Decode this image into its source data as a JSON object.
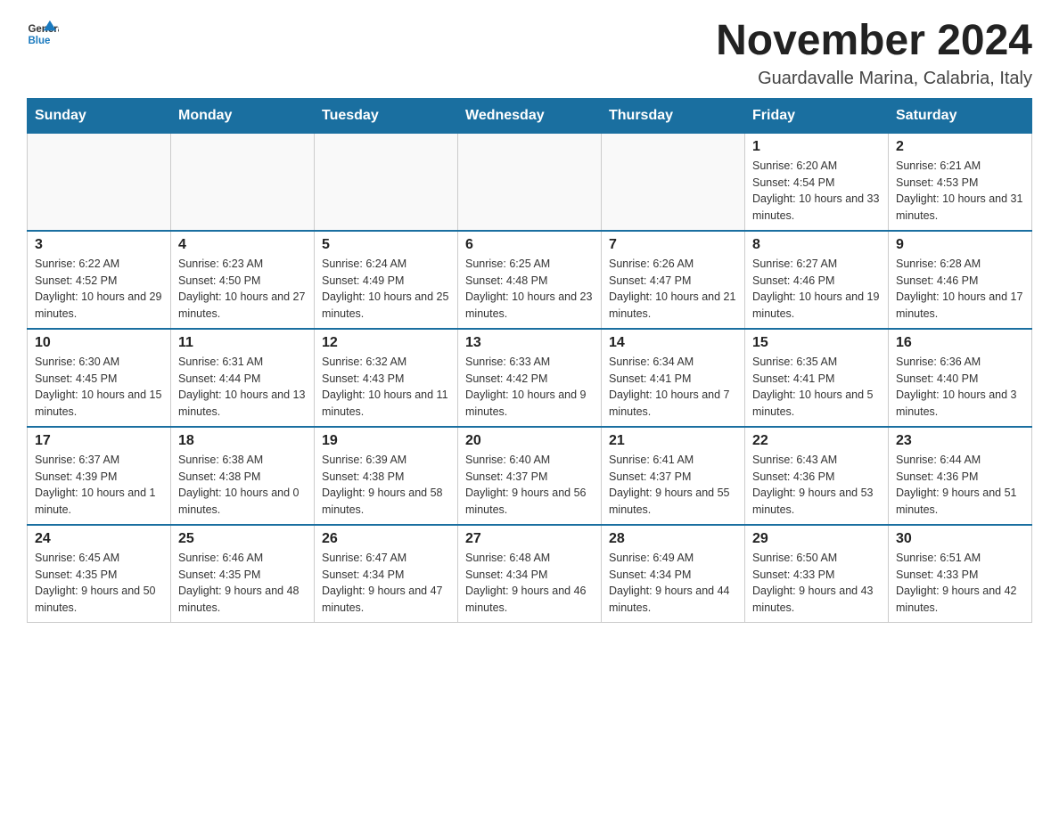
{
  "header": {
    "logo": {
      "text1": "General",
      "text2": "Blue"
    },
    "title": "November 2024",
    "location": "Guardavalle Marina, Calabria, Italy"
  },
  "days_of_week": [
    "Sunday",
    "Monday",
    "Tuesday",
    "Wednesday",
    "Thursday",
    "Friday",
    "Saturday"
  ],
  "weeks": [
    [
      {
        "day": "",
        "info": ""
      },
      {
        "day": "",
        "info": ""
      },
      {
        "day": "",
        "info": ""
      },
      {
        "day": "",
        "info": ""
      },
      {
        "day": "",
        "info": ""
      },
      {
        "day": "1",
        "info": "Sunrise: 6:20 AM\nSunset: 4:54 PM\nDaylight: 10 hours and 33 minutes."
      },
      {
        "day": "2",
        "info": "Sunrise: 6:21 AM\nSunset: 4:53 PM\nDaylight: 10 hours and 31 minutes."
      }
    ],
    [
      {
        "day": "3",
        "info": "Sunrise: 6:22 AM\nSunset: 4:52 PM\nDaylight: 10 hours and 29 minutes."
      },
      {
        "day": "4",
        "info": "Sunrise: 6:23 AM\nSunset: 4:50 PM\nDaylight: 10 hours and 27 minutes."
      },
      {
        "day": "5",
        "info": "Sunrise: 6:24 AM\nSunset: 4:49 PM\nDaylight: 10 hours and 25 minutes."
      },
      {
        "day": "6",
        "info": "Sunrise: 6:25 AM\nSunset: 4:48 PM\nDaylight: 10 hours and 23 minutes."
      },
      {
        "day": "7",
        "info": "Sunrise: 6:26 AM\nSunset: 4:47 PM\nDaylight: 10 hours and 21 minutes."
      },
      {
        "day": "8",
        "info": "Sunrise: 6:27 AM\nSunset: 4:46 PM\nDaylight: 10 hours and 19 minutes."
      },
      {
        "day": "9",
        "info": "Sunrise: 6:28 AM\nSunset: 4:46 PM\nDaylight: 10 hours and 17 minutes."
      }
    ],
    [
      {
        "day": "10",
        "info": "Sunrise: 6:30 AM\nSunset: 4:45 PM\nDaylight: 10 hours and 15 minutes."
      },
      {
        "day": "11",
        "info": "Sunrise: 6:31 AM\nSunset: 4:44 PM\nDaylight: 10 hours and 13 minutes."
      },
      {
        "day": "12",
        "info": "Sunrise: 6:32 AM\nSunset: 4:43 PM\nDaylight: 10 hours and 11 minutes."
      },
      {
        "day": "13",
        "info": "Sunrise: 6:33 AM\nSunset: 4:42 PM\nDaylight: 10 hours and 9 minutes."
      },
      {
        "day": "14",
        "info": "Sunrise: 6:34 AM\nSunset: 4:41 PM\nDaylight: 10 hours and 7 minutes."
      },
      {
        "day": "15",
        "info": "Sunrise: 6:35 AM\nSunset: 4:41 PM\nDaylight: 10 hours and 5 minutes."
      },
      {
        "day": "16",
        "info": "Sunrise: 6:36 AM\nSunset: 4:40 PM\nDaylight: 10 hours and 3 minutes."
      }
    ],
    [
      {
        "day": "17",
        "info": "Sunrise: 6:37 AM\nSunset: 4:39 PM\nDaylight: 10 hours and 1 minute."
      },
      {
        "day": "18",
        "info": "Sunrise: 6:38 AM\nSunset: 4:38 PM\nDaylight: 10 hours and 0 minutes."
      },
      {
        "day": "19",
        "info": "Sunrise: 6:39 AM\nSunset: 4:38 PM\nDaylight: 9 hours and 58 minutes."
      },
      {
        "day": "20",
        "info": "Sunrise: 6:40 AM\nSunset: 4:37 PM\nDaylight: 9 hours and 56 minutes."
      },
      {
        "day": "21",
        "info": "Sunrise: 6:41 AM\nSunset: 4:37 PM\nDaylight: 9 hours and 55 minutes."
      },
      {
        "day": "22",
        "info": "Sunrise: 6:43 AM\nSunset: 4:36 PM\nDaylight: 9 hours and 53 minutes."
      },
      {
        "day": "23",
        "info": "Sunrise: 6:44 AM\nSunset: 4:36 PM\nDaylight: 9 hours and 51 minutes."
      }
    ],
    [
      {
        "day": "24",
        "info": "Sunrise: 6:45 AM\nSunset: 4:35 PM\nDaylight: 9 hours and 50 minutes."
      },
      {
        "day": "25",
        "info": "Sunrise: 6:46 AM\nSunset: 4:35 PM\nDaylight: 9 hours and 48 minutes."
      },
      {
        "day": "26",
        "info": "Sunrise: 6:47 AM\nSunset: 4:34 PM\nDaylight: 9 hours and 47 minutes."
      },
      {
        "day": "27",
        "info": "Sunrise: 6:48 AM\nSunset: 4:34 PM\nDaylight: 9 hours and 46 minutes."
      },
      {
        "day": "28",
        "info": "Sunrise: 6:49 AM\nSunset: 4:34 PM\nDaylight: 9 hours and 44 minutes."
      },
      {
        "day": "29",
        "info": "Sunrise: 6:50 AM\nSunset: 4:33 PM\nDaylight: 9 hours and 43 minutes."
      },
      {
        "day": "30",
        "info": "Sunrise: 6:51 AM\nSunset: 4:33 PM\nDaylight: 9 hours and 42 minutes."
      }
    ]
  ]
}
